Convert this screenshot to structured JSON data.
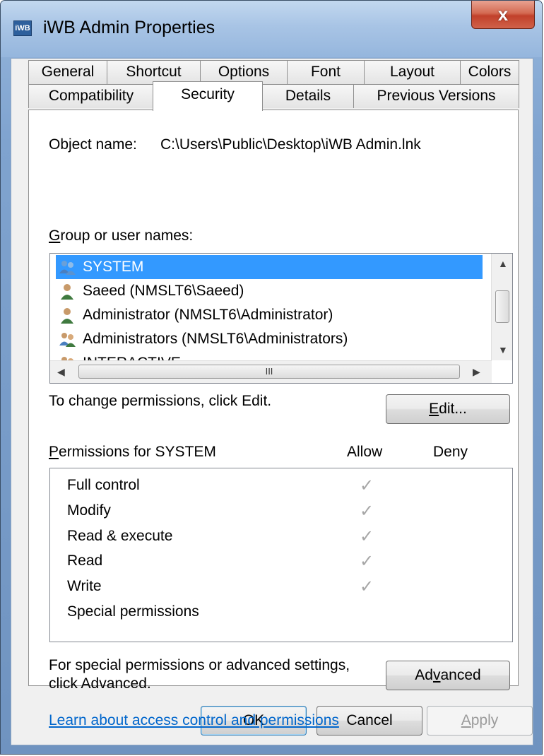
{
  "window": {
    "title": "iWB Admin Properties",
    "icon": "app-icon",
    "close_label": "x"
  },
  "tabs_row1": [
    "General",
    "Shortcut",
    "Options",
    "Font",
    "Layout",
    "Colors"
  ],
  "tabs_row2": [
    "Compatibility",
    "Security",
    "Details",
    "Previous Versions"
  ],
  "active_tab": "Security",
  "object_name": {
    "label": "Object name:",
    "value": "C:\\Users\\Public\\Desktop\\iWB Admin.lnk"
  },
  "groups": {
    "label_prefix": "G",
    "label_rest": "roup or user names:",
    "items": [
      {
        "name": "SYSTEM",
        "icon": "group-users-icon",
        "selected": true
      },
      {
        "name": "Saeed (NMSLT6\\Saeed)",
        "icon": "user-icon",
        "selected": false
      },
      {
        "name": "Administrator (NMSLT6\\Administrator)",
        "icon": "user-icon",
        "selected": false
      },
      {
        "name": "Administrators (NMSLT6\\Administrators)",
        "icon": "group-users-icon",
        "selected": false
      },
      {
        "name": "INTERACTIVE",
        "icon": "group-users-icon",
        "selected": false
      }
    ],
    "hscroll_grip": "III"
  },
  "change_hint": "To change permissions, click Edit.",
  "edit_button": {
    "underlined": "E",
    "rest": "dit..."
  },
  "permissions": {
    "label_prefix": "P",
    "label_rest": "ermissions for SYSTEM",
    "allow_label": "Allow",
    "deny_label": "Deny",
    "rows": [
      {
        "name": "Full control",
        "allow": true,
        "deny": false
      },
      {
        "name": "Modify",
        "allow": true,
        "deny": false
      },
      {
        "name": "Read & execute",
        "allow": true,
        "deny": false
      },
      {
        "name": "Read",
        "allow": true,
        "deny": false
      },
      {
        "name": "Write",
        "allow": true,
        "deny": false
      },
      {
        "name": "Special permissions",
        "allow": false,
        "deny": false
      }
    ],
    "check_glyph": "✓"
  },
  "advanced_hint": [
    "For special permissions or advanced settings,",
    "click Advanced."
  ],
  "advanced_button": {
    "pre": "Ad",
    "underlined": "v",
    "post": "anced"
  },
  "learn_link": "Learn about access control and permissions",
  "footer": {
    "ok": "OK",
    "cancel": "Cancel",
    "apply_underlined": "A",
    "apply_rest": "pply"
  },
  "colors": {
    "selection": "#3399ff",
    "link": "#0066cc",
    "close": "#c1402a"
  }
}
